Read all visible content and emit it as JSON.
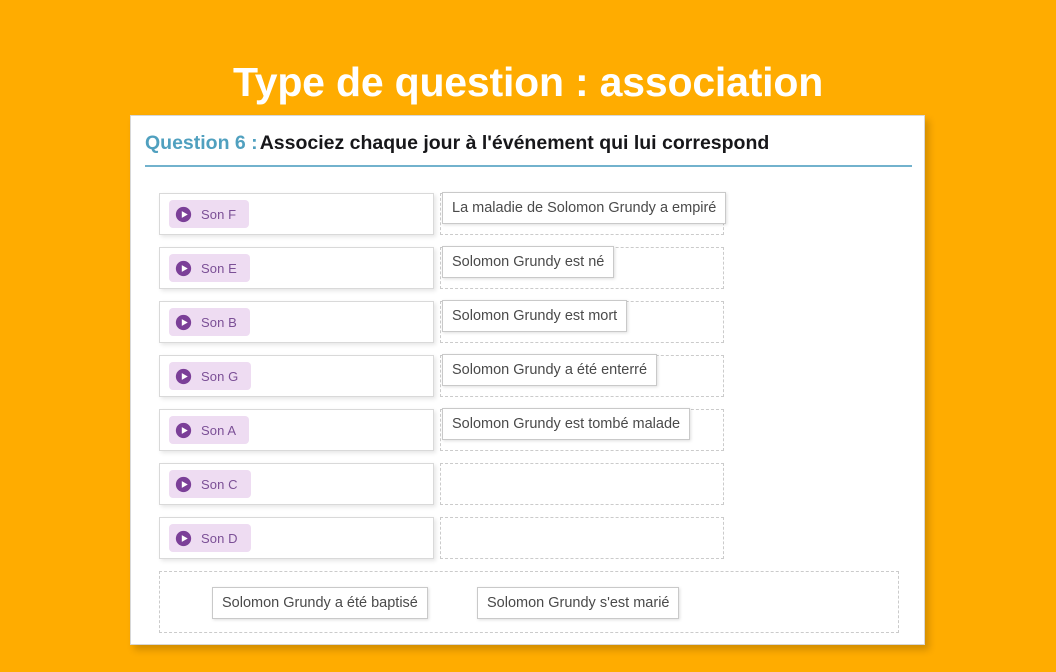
{
  "page": {
    "title": "Type de question : association",
    "background_color": "#ffac00",
    "title_color": "#ffffff"
  },
  "card": {
    "question_number_label": "Question 6 :",
    "question_text": "Associez chaque jour à l'événement qui lui correspond",
    "accent_color": "#50a0bf",
    "underline_color": "#72b2cd"
  },
  "audio_rows": [
    {
      "label": "Son F",
      "icon": "play-icon"
    },
    {
      "label": "Son E",
      "icon": "play-icon"
    },
    {
      "label": "Son B",
      "icon": "play-icon"
    },
    {
      "label": "Son G",
      "icon": "play-icon"
    },
    {
      "label": "Son A",
      "icon": "play-icon"
    },
    {
      "label": "Son C",
      "icon": "play-icon"
    },
    {
      "label": "Son D",
      "icon": "play-icon"
    }
  ],
  "drop_zones": [
    {
      "answer": "La maladie de Solomon Grundy a empiré",
      "filled": true
    },
    {
      "answer": "Solomon Grundy est né",
      "filled": true
    },
    {
      "answer": "Solomon Grundy est mort",
      "filled": true
    },
    {
      "answer": "Solomon Grundy a été enterré",
      "filled": true
    },
    {
      "answer": "Solomon Grundy est tombé malade",
      "filled": true
    },
    {
      "answer": "",
      "filled": false
    },
    {
      "answer": "",
      "filled": false
    }
  ],
  "answer_bank": [
    {
      "label": "Solomon Grundy a été baptisé"
    },
    {
      "label": "Solomon Grundy s'est marié"
    }
  ],
  "colors": {
    "audio_chip_background": "#eedcf2",
    "audio_chip_text": "#7b4f96",
    "play_icon_fill": "#7b3f98",
    "chip_border": "#c9c9c9",
    "dashed_border": "#cbcbcb"
  }
}
